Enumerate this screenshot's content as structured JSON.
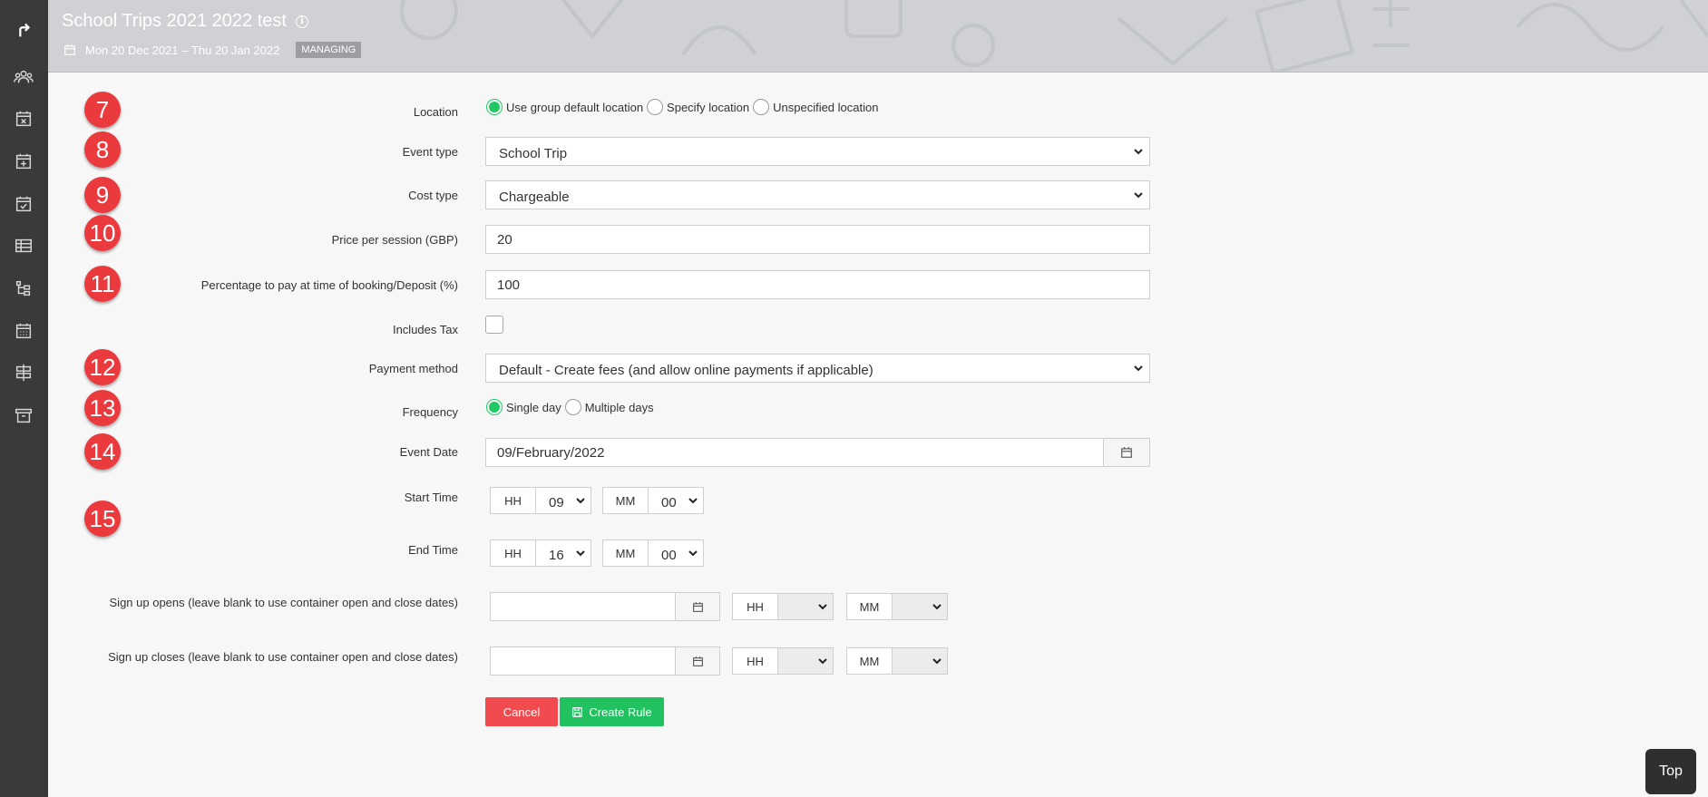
{
  "header": {
    "title": "School Trips 2021 2022 test",
    "date_range": "Mon 20 Dec 2021 – Thu 20 Jan 2022",
    "badge": "MANAGING"
  },
  "sidebar": {
    "icons": [
      "back-arrow-icon",
      "groups-icon",
      "calendar-x-icon",
      "calendar-plus-icon",
      "calendar-check-icon",
      "table-icon",
      "flow-icon",
      "calendar-grid-icon",
      "signpost-icon",
      "archive-icon"
    ]
  },
  "form": {
    "location": {
      "step": "7",
      "label": "Location",
      "options": [
        "Use group default location",
        "Specify location",
        "Unspecified location"
      ],
      "selected": "Use group default location"
    },
    "event_type": {
      "step": "8",
      "label": "Event type",
      "value": "School Trip"
    },
    "cost_type": {
      "step": "9",
      "label": "Cost type",
      "value": "Chargeable"
    },
    "price": {
      "step": "10",
      "label": "Price per session (GBP)",
      "value": "20"
    },
    "deposit": {
      "step": "11",
      "label": "Percentage to pay at time of booking/Deposit (%)",
      "value": "100"
    },
    "includes_tax": {
      "label": "Includes Tax",
      "checked": false
    },
    "payment_method": {
      "step": "12",
      "label": "Payment method",
      "value": "Default - Create fees (and allow online payments if applicable)"
    },
    "frequency": {
      "step": "13",
      "label": "Frequency",
      "options": [
        "Single day",
        "Multiple days"
      ],
      "selected": "Single day"
    },
    "event_date": {
      "step": "14",
      "label": "Event Date",
      "value": "09/February/2022"
    },
    "times_step": "15",
    "start_time": {
      "label": "Start Time",
      "hh_label": "HH",
      "hh": "09",
      "mm_label": "MM",
      "mm": "00"
    },
    "end_time": {
      "label": "End Time",
      "hh_label": "HH",
      "hh": "16",
      "mm_label": "MM",
      "mm": "00"
    },
    "signup_opens": {
      "label": "Sign up opens (leave blank to use container open and close dates)",
      "hh_label": "HH",
      "mm_label": "MM"
    },
    "signup_closes": {
      "label": "Sign up closes (leave blank to use container open and close dates)",
      "hh_label": "HH",
      "mm_label": "MM"
    },
    "cancel_label": "Cancel",
    "create_label": "Create Rule"
  },
  "top_button": "Top",
  "colors": {
    "accent_green": "#21c15f",
    "cancel_red": "#f24b4f",
    "step_red": "#ea3a3e",
    "sidebar": "#3a3a3a"
  }
}
